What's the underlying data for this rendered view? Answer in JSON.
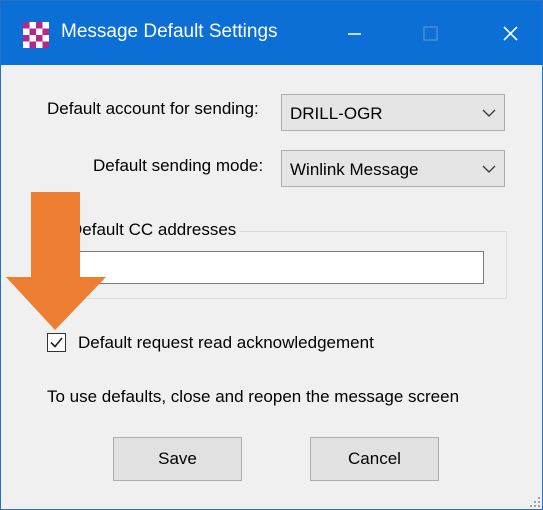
{
  "window": {
    "title": "Message Default Settings"
  },
  "form": {
    "account_label": "Default account for sending:",
    "account_value": "DRILL-OGR",
    "mode_label": "Default sending mode:",
    "mode_value": "Winlink Message",
    "cc_group_title": "Default CC addresses",
    "cc_value": "",
    "read_ack_label": "Default request read acknowledgement",
    "read_ack_checked": true,
    "hint_text": "To use defaults, close and reopen the message screen"
  },
  "buttons": {
    "save_label": "Save",
    "cancel_label": "Cancel"
  },
  "icons": {
    "app": "checkered-app-icon",
    "minimize": "minimize-icon",
    "maximize": "maximize-icon",
    "close": "close-icon",
    "dropdown": "chevron-down-icon",
    "check": "checkmark-icon",
    "annotation": "down-arrow-annotation",
    "grip": "resize-grip-icon"
  },
  "colors": {
    "titlebar": "#0b6fd6",
    "annotation_arrow": "#ed7d31",
    "window_bg": "#f0f0f0"
  }
}
